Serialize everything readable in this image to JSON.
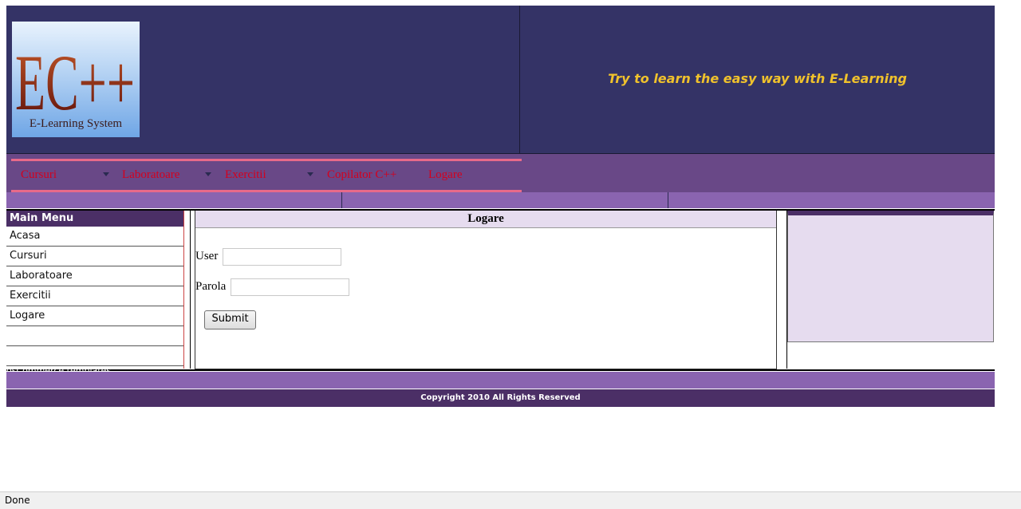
{
  "header": {
    "logo_text": "EC++",
    "logo_subtitle": "E-Learning System",
    "tagline": "Try to learn the easy way with E-Learning"
  },
  "nav": {
    "items": [
      {
        "label": "Cursuri",
        "has_dropdown": true
      },
      {
        "label": "Laboratoare",
        "has_dropdown": true
      },
      {
        "label": "Exercitii",
        "has_dropdown": true
      },
      {
        "label": "Copilator C++",
        "has_dropdown": false
      },
      {
        "label": "Logare",
        "has_dropdown": false
      }
    ]
  },
  "sidebar": {
    "title": "Main Menu",
    "items": [
      {
        "label": "Acasa"
      },
      {
        "label": "Cursuri"
      },
      {
        "label": "Laboratoare"
      },
      {
        "label": "Exercitii"
      },
      {
        "label": "Logare"
      },
      {
        "label": ""
      },
      {
        "label": ""
      }
    ]
  },
  "login": {
    "title": "Logare",
    "user_label": "User",
    "user_value": "",
    "password_label": "Parola",
    "password_value": "",
    "submit_label": "Submit"
  },
  "footer": {
    "link_text": "osCommerce templates",
    "copyright": "Copyright 2010 All Rights Reserved"
  },
  "status": {
    "text": "Done"
  },
  "colors": {
    "header_bg": "#343366",
    "nav_bg": "#694887",
    "nav_text": "#d4001e",
    "tagline": "#f0c22c",
    "menu_title_bg": "#4b2f66",
    "panel_bg": "#e6dcef"
  }
}
